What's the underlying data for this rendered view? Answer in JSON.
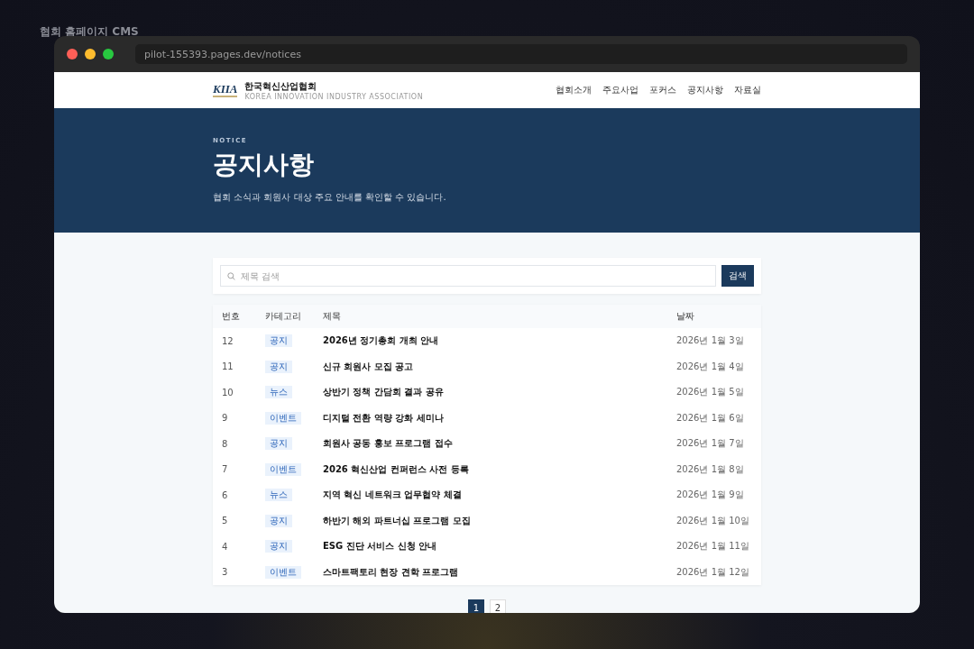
{
  "app_title": "협회 홈페이지 CMS",
  "browser": {
    "url": "pilot-155393.pages.dev/notices"
  },
  "site_header": {
    "logo": "KIIA",
    "org_name": "한국혁신산업협회",
    "org_subtitle": "KOREA INNOVATION INDUSTRY ASSOCIATION",
    "nav": [
      "협회소개",
      "주요사업",
      "포커스",
      "공지사항",
      "자료실"
    ]
  },
  "hero": {
    "eyebrow": "NOTICE",
    "title": "공지사항",
    "description": "협회 소식과 회원사 대상 주요 안내를 확인할 수 있습니다."
  },
  "search": {
    "placeholder": "제목 검색",
    "button": "검색"
  },
  "table": {
    "columns": [
      "번호",
      "카테고리",
      "제목",
      "날짜"
    ],
    "rows": [
      {
        "number": "12",
        "category": "공지",
        "title": "2026년 정기총회 개최 안내",
        "date": "2026년 1월 3일"
      },
      {
        "number": "11",
        "category": "공지",
        "title": "신규 회원사 모집 공고",
        "date": "2026년 1월 4일"
      },
      {
        "number": "10",
        "category": "뉴스",
        "title": "상반기 정책 간담회 결과 공유",
        "date": "2026년 1월 5일"
      },
      {
        "number": "9",
        "category": "이벤트",
        "title": "디지털 전환 역량 강화 세미나",
        "date": "2026년 1월 6일"
      },
      {
        "number": "8",
        "category": "공지",
        "title": "회원사 공동 홍보 프로그램 접수",
        "date": "2026년 1월 7일"
      },
      {
        "number": "7",
        "category": "이벤트",
        "title": "2026 혁신산업 컨퍼런스 사전 등록",
        "date": "2026년 1월 8일"
      },
      {
        "number": "6",
        "category": "뉴스",
        "title": "지역 혁신 네트워크 업무협약 체결",
        "date": "2026년 1월 9일"
      },
      {
        "number": "5",
        "category": "공지",
        "title": "하반기 해외 파트너십 프로그램 모집",
        "date": "2026년 1월 10일"
      },
      {
        "number": "4",
        "category": "공지",
        "title": "ESG 진단 서비스 신청 안내",
        "date": "2026년 1월 11일"
      },
      {
        "number": "3",
        "category": "이벤트",
        "title": "스마트팩토리 현장 견학 프로그램",
        "date": "2026년 1월 12일"
      }
    ]
  },
  "pagination": [
    {
      "label": "1",
      "selected": true
    },
    {
      "label": "2",
      "selected": false
    }
  ]
}
